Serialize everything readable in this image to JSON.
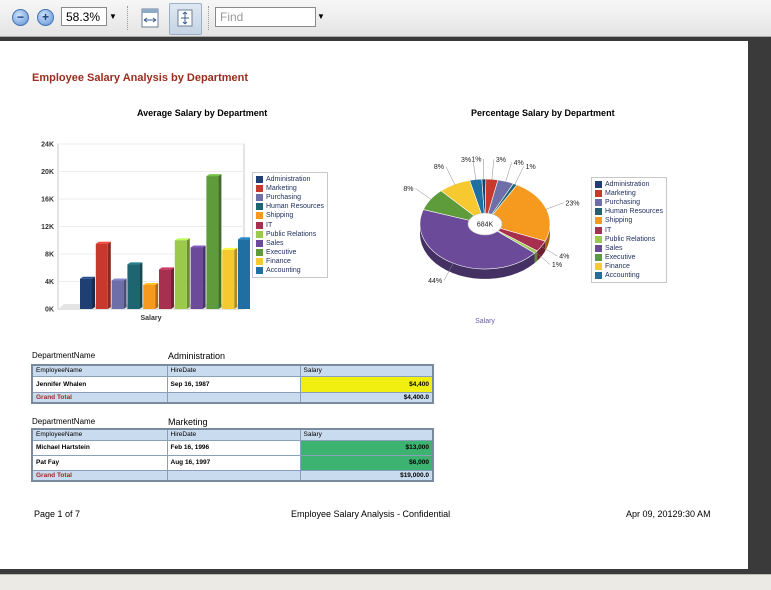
{
  "toolbar": {
    "zoom_value": "58.3%",
    "find_placeholder": "Find"
  },
  "report": {
    "title": "Employee Salary Analysis by Department",
    "footer_left": "Page 1 of 7",
    "footer_center": "Employee Salary Analysis - Confidential",
    "footer_right": "Apr 09, 20129:30 AM"
  },
  "colors": {
    "Administration": "#1f3f73",
    "Marketing": "#c8392d",
    "Purchasing": "#6e6ea8",
    "Human Resources": "#1d6570",
    "Shipping": "#f59a1f",
    "IT": "#a8304f",
    "Public Relations": "#9bc94a",
    "Sales": "#6a4a99",
    "Executive": "#5e9b3a",
    "Finance": "#f7c931",
    "Accounting": "#1f6fa3"
  },
  "chart_data": [
    {
      "type": "bar",
      "title": "Average Salary by Department",
      "xlabel": "Salary",
      "ylabel": "",
      "categories": [
        "Salary"
      ],
      "y_ticks": [
        "0K",
        "4K",
        "8K",
        "12K",
        "16K",
        "20K",
        "24K"
      ],
      "ylim": [
        0,
        24000
      ],
      "legend_position": "right",
      "series": [
        {
          "name": "Administration",
          "values": [
            4400
          ]
        },
        {
          "name": "Marketing",
          "values": [
            9500
          ]
        },
        {
          "name": "Purchasing",
          "values": [
            4150
          ]
        },
        {
          "name": "Human Resources",
          "values": [
            6500
          ]
        },
        {
          "name": "Shipping",
          "values": [
            3500
          ]
        },
        {
          "name": "IT",
          "values": [
            5760
          ]
        },
        {
          "name": "Public Relations",
          "values": [
            10000
          ]
        },
        {
          "name": "Sales",
          "values": [
            8950
          ]
        },
        {
          "name": "Executive",
          "values": [
            19333
          ]
        },
        {
          "name": "Finance",
          "values": [
            8600
          ]
        },
        {
          "name": "Accounting",
          "values": [
            10150
          ]
        }
      ]
    },
    {
      "type": "pie",
      "title": "Percentage Salary by Department",
      "xlabel": "Salary",
      "center_label": "684K",
      "legend_position": "right",
      "series": [
        {
          "name": "Administration",
          "value": 1,
          "label": "1%"
        },
        {
          "name": "Marketing",
          "value": 3,
          "label": "3%"
        },
        {
          "name": "Purchasing",
          "value": 4,
          "label": "4%"
        },
        {
          "name": "Human Resources",
          "value": 1,
          "label": "1%"
        },
        {
          "name": "Shipping",
          "value": 23,
          "label": "23%"
        },
        {
          "name": "IT",
          "value": 4,
          "label": "4%"
        },
        {
          "name": "Public Relations",
          "value": 1,
          "label": "1%"
        },
        {
          "name": "Sales",
          "value": 44,
          "label": "44%"
        },
        {
          "name": "Executive",
          "value": 8,
          "label": "8%"
        },
        {
          "name": "Finance",
          "value": 8,
          "label": "8%"
        },
        {
          "name": "Accounting",
          "value": 3,
          "label": "3%"
        }
      ]
    }
  ],
  "tables": {
    "dept_label": "DepartmentName",
    "columns": [
      "EmployeeName",
      "HireDate",
      "Salary"
    ],
    "grand_total_label": "Grand Total",
    "groups": [
      {
        "department": "Administration",
        "rows": [
          {
            "name": "Jennifer Whalen",
            "hire": "Sep 16, 1987",
            "salary": "$4,400"
          }
        ],
        "total": "$4,400.0"
      },
      {
        "department": "Marketing",
        "rows": [
          {
            "name": "Michael Hartstein",
            "hire": "Feb 16, 1996",
            "salary": "$13,000"
          },
          {
            "name": "Pat Fay",
            "hire": "Aug 16, 1997",
            "salary": "$6,000"
          }
        ],
        "total": "$19,000.0"
      }
    ]
  }
}
